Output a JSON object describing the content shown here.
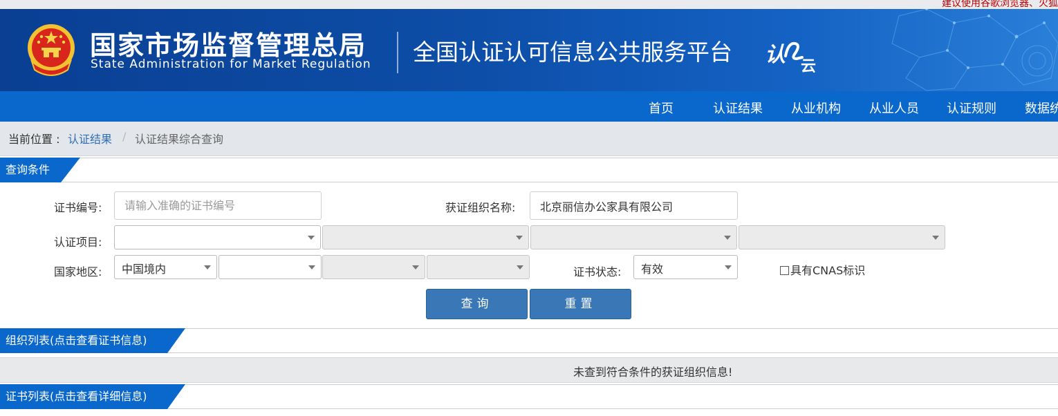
{
  "top_notice": "建议使用谷歌浏览器、火狐",
  "header": {
    "org_name_cn": "国家市场监督管理总局",
    "org_name_en": "State Administration  for  Market Regulation",
    "platform_title": "全国认证认可信息公共服务平台",
    "logo_text_1": "认",
    "logo_text_2": "云"
  },
  "nav": {
    "items": [
      {
        "label": "首页"
      },
      {
        "label": "认证结果"
      },
      {
        "label": "从业机构"
      },
      {
        "label": "从业人员"
      },
      {
        "label": "认证规则"
      },
      {
        "label": "数据统"
      }
    ]
  },
  "breadcrumb": {
    "prefix": "当前位置 : ",
    "link": "认证结果",
    "separator": "/",
    "current": "认证结果综合查询"
  },
  "query": {
    "section_title": "查询条件",
    "cert_no_label": "证书编号:",
    "cert_no_placeholder": "请输入准确的证书编号",
    "org_name_label": "获证组织名称:",
    "org_name_value": "北京丽信办公家具有限公司",
    "project_label": "认证项目:",
    "region_label": "国家地区:",
    "region_value": "中国境内",
    "status_label": "证书状态:",
    "status_value": "有效",
    "cnas_label": "具有CNAS标识",
    "search_button": "查询",
    "reset_button": "重置"
  },
  "org_list": {
    "section_title": "组织列表(点击查看证书信息)",
    "empty_message": "未查到符合条件的获证组织信息!"
  },
  "cert_list": {
    "section_title": "证书列表(点击查看详细信息)"
  },
  "colors": {
    "banner_blue": "#0d4ea8",
    "nav_blue": "#0a68cd",
    "button_blue": "#3a77b6",
    "link_blue": "#2f6fb5",
    "notice_red": "#c00000"
  }
}
